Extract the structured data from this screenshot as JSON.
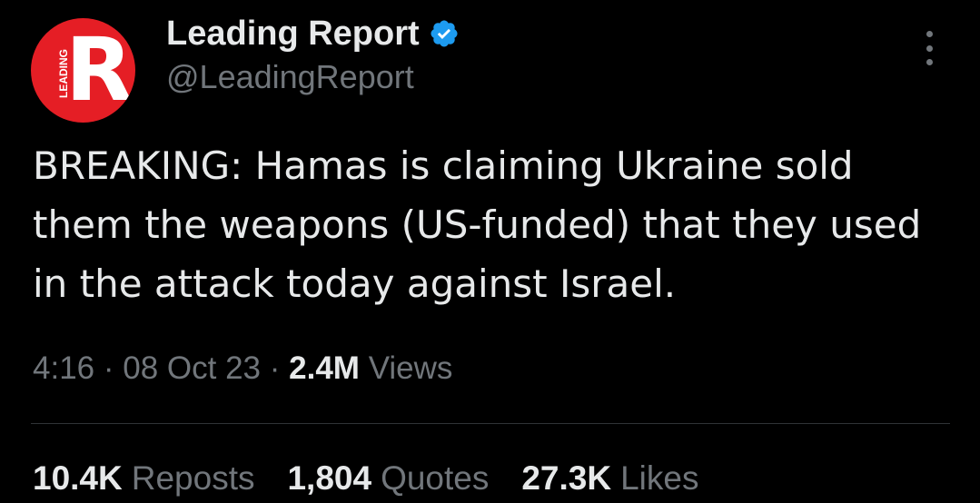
{
  "tweet": {
    "author": {
      "display_name": "Leading Report",
      "handle": "@LeadingReport",
      "verified": true,
      "avatar_letter": "R",
      "avatar_side_text": "LEADING",
      "avatar_color": "#e51e25",
      "verified_color": "#1d9bf0"
    },
    "text": "BREAKING: Hamas is claiming Ukraine sold them the weapons (US-funded) that they used in the attack today against Israel.",
    "time": "4:16",
    "separator": "·",
    "date": "08 Oct 23",
    "views_count": "2.4M",
    "views_label": "Views",
    "stats": [
      {
        "count": "10.4K",
        "label": "Reposts"
      },
      {
        "count": "1,804",
        "label": "Quotes"
      },
      {
        "count": "27.3K",
        "label": "Likes"
      }
    ],
    "more_icon": "more-vertical-icon"
  }
}
